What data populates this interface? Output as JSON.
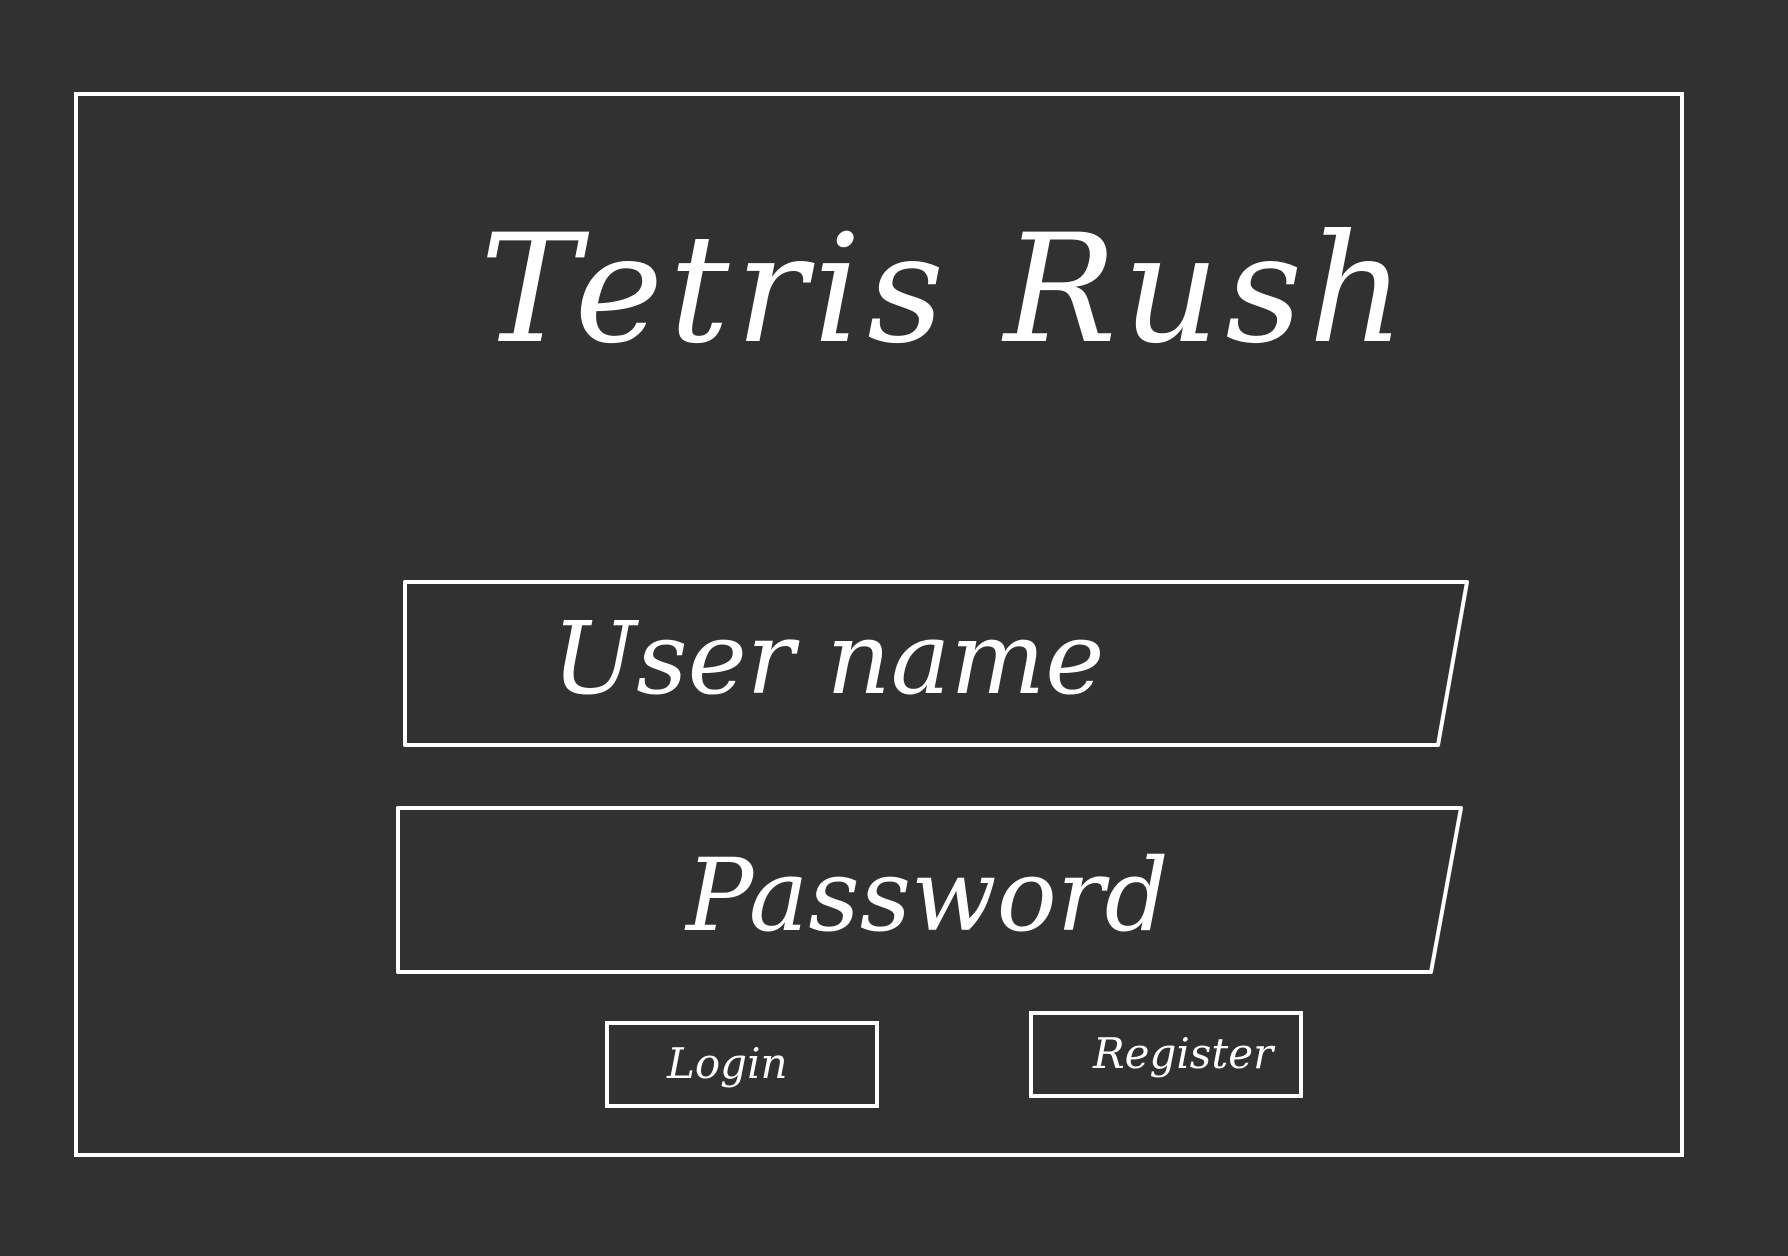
{
  "app": {
    "title": "Tetris Rush"
  },
  "form": {
    "username": {
      "placeholder": "User name",
      "value": ""
    },
    "password": {
      "placeholder": "Password",
      "value": ""
    }
  },
  "buttons": {
    "login_label": "Login",
    "register_label": "Register"
  },
  "colors": {
    "background": "#313131",
    "stroke": "#ffffff"
  }
}
